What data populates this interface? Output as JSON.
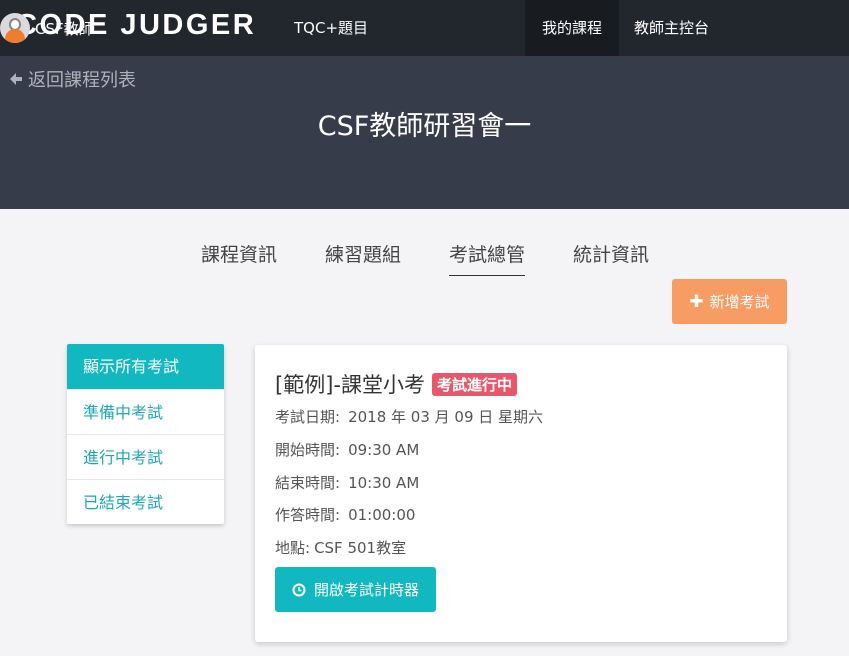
{
  "navbar": {
    "brand": "CODE JUDGER",
    "links": {
      "tqc": "TQC+題目",
      "my_courses": "我的課程",
      "teacher_console": "教師主控台"
    },
    "user": {
      "name": "CSF教師",
      "avatar_icon": "user-avatar-icon"
    }
  },
  "hero": {
    "back_label": "返回課程列表",
    "back_icon": "arrow-left-icon",
    "course_title": "CSF教師研習會一"
  },
  "tabs": {
    "course_info": "課程資訊",
    "practice_sets": "練習題組",
    "exam_manage": "考試總管",
    "statistics": "統計資訊",
    "active": "考試總管"
  },
  "add_exam_button": {
    "label": "新增考試",
    "icon": "plus-icon"
  },
  "sidebar": {
    "items": [
      {
        "label": "顯示所有考試",
        "active": true
      },
      {
        "label": "準備中考試",
        "active": false
      },
      {
        "label": "進行中考試",
        "active": false
      },
      {
        "label": "已結束考試",
        "active": false
      }
    ]
  },
  "exam_card": {
    "title": "[範例]-課堂小考",
    "status_badge": "考試進行中",
    "date_label": "考試日期:",
    "date_value": "2018 年 03 月 09 日 星期六",
    "start_label": "開始時間:",
    "start_value": "09:30 AM",
    "end_label": "結束時間:",
    "end_value": "10:30 AM",
    "duration_label": "作答時間:",
    "duration_value": "01:00:00",
    "location_label": "地點:",
    "location_value": "CSF 501教室",
    "timer_button_label": "開啟考試計時器",
    "timer_icon": "clock-icon"
  },
  "colors": {
    "navbar_bg": "#22262d",
    "hero_bg": "#363c4a",
    "accent_teal": "#12b8c0",
    "accent_orange": "#f79d63",
    "badge_red": "#e8576b",
    "page_bg": "#f4f4f7"
  }
}
